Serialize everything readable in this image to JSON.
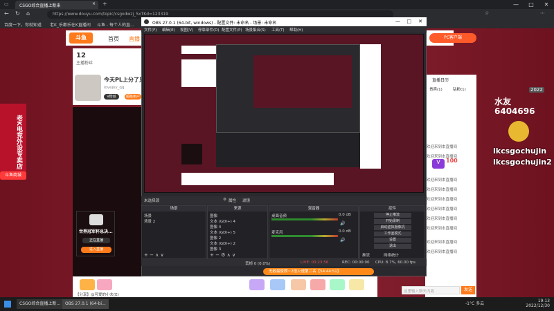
{
  "browser": {
    "tab_title": "CSGO综合直播上新来",
    "url": "https://www.douyu.com/topic/csgodwzj_5xTKd=123319",
    "bookmarks": [
      "百度一下，你就知道",
      "老K_乐都乐在K直播间",
      "斗鱼 - 每个人的直..."
    ],
    "controls": [
      "—",
      "□",
      "✕"
    ]
  },
  "site": {
    "logo": "斗鱼",
    "nav": [
      "首页",
      "直播"
    ],
    "stats": [
      {
        "value": "12",
        "label": "主播粉丝"
      }
    ],
    "streamer_title": "今天PL上分了兄",
    "streamer_sub": "lovejoy_qq",
    "follow_label": "V粉丝",
    "tag_label": "超级用户",
    "side_badge": "老K电竞外设专卖店",
    "side_bottom": "斗鱼商城",
    "promo_title": "世界冠军杯总决...",
    "promo_sub": "正在直播",
    "promo_btn": "进入直播",
    "right_header": "PC客户端",
    "chat_tabs": [
      "直播日历",
      "贵宾(1)",
      "钻粉(1)"
    ],
    "chat_lines": [
      "欢迎来到本直播间",
      "欢迎来到本直播间",
      "欢迎来到本直播间",
      "欢迎来到本直播间",
      "欢迎来到本直播间",
      "欢迎来到本直播间",
      "欢迎来到本直播间",
      "欢迎来到本直播间",
      "欢迎来到本直播间",
      "欢迎来到本直播间"
    ],
    "chat_input_placeholder": "这里输入聊天内容",
    "send_label": "发送",
    "overlay_big": "水友",
    "overlay_number": "6404696",
    "overlay_name1": "lkcsgochujin",
    "overlay_name2": "lkcsgochujin2",
    "overlay_year": "2022",
    "overlay_v": "V",
    "overlay_v_num": "100",
    "bottom_status": "【分享】@可爱的小夫(E)",
    "notice_text": "无敌最俊朗~2倍火速第二名【54:44:51】"
  },
  "obs": {
    "title": "OBS 27.0.1 (64-bit, windows) - 配置文件: 未命名 - 场景: 未命名",
    "menu": [
      "文件(F)",
      "编辑(E)",
      "视图(V)",
      "停靠部件(D)",
      "配置文件(P)",
      "场景集合(S)",
      "工具(T)",
      "帮助(H)"
    ],
    "source_bar_label": "未选择源",
    "props_label": "属性",
    "filters_label": "滤镜",
    "panels": {
      "scenes": "场景",
      "sources": "来源",
      "mixer": "混音器",
      "controls": "控件"
    },
    "scene_list": [
      "场景",
      "场景 2"
    ],
    "source_list": [
      "图像",
      "文本 (GDI+) 4",
      "图像 4",
      "文本 (GDI+) 5",
      "图像 2",
      "文本 (GDI+) 2",
      "图像 3"
    ],
    "mixer_tracks": [
      {
        "name": "桌面音频",
        "db": "0.0 dB"
      },
      {
        "name": "麦克风",
        "db": "0.0 dB"
      }
    ],
    "control_buttons": [
      "停止推流",
      "开始录制",
      "启动虚拟摄像机",
      "工作室模式",
      "设置",
      "退出"
    ],
    "control_extra": [
      "推流",
      "网络统计"
    ],
    "status": [
      "丢帧 0 (0.0%)",
      "LIVE: 00:23:56",
      "REC: 00:00:00",
      "CPU: 8.7%, 60.00 fps"
    ]
  },
  "taskbar": {
    "items": [
      "CSGO综合直播上新...",
      "OBS 27.0.1 (64-bi..."
    ],
    "weather": "-1°C 多云",
    "time": "19:13",
    "date": "2022/12/30"
  },
  "colors": {
    "accent": "#ff7a1a",
    "page_bg": "#7a1b2a",
    "obs_bg": "#2a2a2e"
  }
}
